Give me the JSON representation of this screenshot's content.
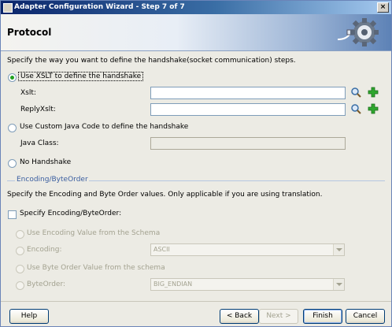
{
  "window": {
    "title": "Adapter Configuration Wizard - Step 7 of 7",
    "close_glyph": "×",
    "page_title": "Protocol"
  },
  "main": {
    "description": "Specify the way you want to define the handshake(socket communication) steps.",
    "options": {
      "xslt": {
        "label": "Use XSLT to define the handshake",
        "selected": true
      },
      "xslt_label": "Xslt:",
      "reply_xslt_label": "ReplyXslt:",
      "custom_java": {
        "label": "Use Custom Java Code to define the handshake",
        "selected": false
      },
      "java_class_label": "Java Class:",
      "no_handshake": {
        "label": "No Handshake",
        "selected": false
      }
    },
    "xslt_value": "",
    "reply_xslt_value": "",
    "java_class_value": ""
  },
  "encoding": {
    "section_title": "Encoding/ByteOrder",
    "description": "Specify the Encoding and Byte Order values. Only applicable if you are using translation.",
    "specify_checkbox_label": "Specify Encoding/ByteOrder:",
    "specify_checked": false,
    "use_schema_encoding_label": "Use Encoding Value from the Schema",
    "encoding_label": "Encoding:",
    "encoding_value": "ASCII",
    "use_schema_byteorder_label": "Use Byte Order Value from the schema",
    "byteorder_label": "ByteOrder:",
    "byteorder_value": "BIG_ENDIAN"
  },
  "footer": {
    "help": "Help",
    "back": "< Back",
    "next": "Next >",
    "finish": "Finish",
    "cancel": "Cancel"
  },
  "colors": {
    "title_bar": "#0a246a",
    "radio_selected": "#21a121",
    "add_icon": "#2ea62e",
    "section_title": "#3a5ea0"
  },
  "icons": [
    "app-icon",
    "gear-plug-icon",
    "search-icon",
    "add-icon",
    "dropdown-arrow-icon"
  ]
}
